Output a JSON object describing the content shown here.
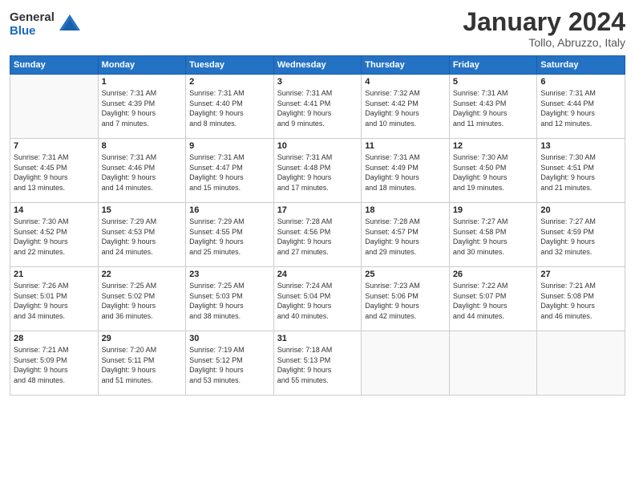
{
  "logo": {
    "general": "General",
    "blue": "Blue"
  },
  "title": "January 2024",
  "location": "Tollo, Abruzzo, Italy",
  "days_of_week": [
    "Sunday",
    "Monday",
    "Tuesday",
    "Wednesday",
    "Thursday",
    "Friday",
    "Saturday"
  ],
  "weeks": [
    [
      {
        "day": "",
        "info": ""
      },
      {
        "day": "1",
        "info": "Sunrise: 7:31 AM\nSunset: 4:39 PM\nDaylight: 9 hours\nand 7 minutes."
      },
      {
        "day": "2",
        "info": "Sunrise: 7:31 AM\nSunset: 4:40 PM\nDaylight: 9 hours\nand 8 minutes."
      },
      {
        "day": "3",
        "info": "Sunrise: 7:31 AM\nSunset: 4:41 PM\nDaylight: 9 hours\nand 9 minutes."
      },
      {
        "day": "4",
        "info": "Sunrise: 7:32 AM\nSunset: 4:42 PM\nDaylight: 9 hours\nand 10 minutes."
      },
      {
        "day": "5",
        "info": "Sunrise: 7:31 AM\nSunset: 4:43 PM\nDaylight: 9 hours\nand 11 minutes."
      },
      {
        "day": "6",
        "info": "Sunrise: 7:31 AM\nSunset: 4:44 PM\nDaylight: 9 hours\nand 12 minutes."
      }
    ],
    [
      {
        "day": "7",
        "info": "Sunrise: 7:31 AM\nSunset: 4:45 PM\nDaylight: 9 hours\nand 13 minutes."
      },
      {
        "day": "8",
        "info": "Sunrise: 7:31 AM\nSunset: 4:46 PM\nDaylight: 9 hours\nand 14 minutes."
      },
      {
        "day": "9",
        "info": "Sunrise: 7:31 AM\nSunset: 4:47 PM\nDaylight: 9 hours\nand 15 minutes."
      },
      {
        "day": "10",
        "info": "Sunrise: 7:31 AM\nSunset: 4:48 PM\nDaylight: 9 hours\nand 17 minutes."
      },
      {
        "day": "11",
        "info": "Sunrise: 7:31 AM\nSunset: 4:49 PM\nDaylight: 9 hours\nand 18 minutes."
      },
      {
        "day": "12",
        "info": "Sunrise: 7:30 AM\nSunset: 4:50 PM\nDaylight: 9 hours\nand 19 minutes."
      },
      {
        "day": "13",
        "info": "Sunrise: 7:30 AM\nSunset: 4:51 PM\nDaylight: 9 hours\nand 21 minutes."
      }
    ],
    [
      {
        "day": "14",
        "info": "Sunrise: 7:30 AM\nSunset: 4:52 PM\nDaylight: 9 hours\nand 22 minutes."
      },
      {
        "day": "15",
        "info": "Sunrise: 7:29 AM\nSunset: 4:53 PM\nDaylight: 9 hours\nand 24 minutes."
      },
      {
        "day": "16",
        "info": "Sunrise: 7:29 AM\nSunset: 4:55 PM\nDaylight: 9 hours\nand 25 minutes."
      },
      {
        "day": "17",
        "info": "Sunrise: 7:28 AM\nSunset: 4:56 PM\nDaylight: 9 hours\nand 27 minutes."
      },
      {
        "day": "18",
        "info": "Sunrise: 7:28 AM\nSunset: 4:57 PM\nDaylight: 9 hours\nand 29 minutes."
      },
      {
        "day": "19",
        "info": "Sunrise: 7:27 AM\nSunset: 4:58 PM\nDaylight: 9 hours\nand 30 minutes."
      },
      {
        "day": "20",
        "info": "Sunrise: 7:27 AM\nSunset: 4:59 PM\nDaylight: 9 hours\nand 32 minutes."
      }
    ],
    [
      {
        "day": "21",
        "info": "Sunrise: 7:26 AM\nSunset: 5:01 PM\nDaylight: 9 hours\nand 34 minutes."
      },
      {
        "day": "22",
        "info": "Sunrise: 7:25 AM\nSunset: 5:02 PM\nDaylight: 9 hours\nand 36 minutes."
      },
      {
        "day": "23",
        "info": "Sunrise: 7:25 AM\nSunset: 5:03 PM\nDaylight: 9 hours\nand 38 minutes."
      },
      {
        "day": "24",
        "info": "Sunrise: 7:24 AM\nSunset: 5:04 PM\nDaylight: 9 hours\nand 40 minutes."
      },
      {
        "day": "25",
        "info": "Sunrise: 7:23 AM\nSunset: 5:06 PM\nDaylight: 9 hours\nand 42 minutes."
      },
      {
        "day": "26",
        "info": "Sunrise: 7:22 AM\nSunset: 5:07 PM\nDaylight: 9 hours\nand 44 minutes."
      },
      {
        "day": "27",
        "info": "Sunrise: 7:21 AM\nSunset: 5:08 PM\nDaylight: 9 hours\nand 46 minutes."
      }
    ],
    [
      {
        "day": "28",
        "info": "Sunrise: 7:21 AM\nSunset: 5:09 PM\nDaylight: 9 hours\nand 48 minutes."
      },
      {
        "day": "29",
        "info": "Sunrise: 7:20 AM\nSunset: 5:11 PM\nDaylight: 9 hours\nand 51 minutes."
      },
      {
        "day": "30",
        "info": "Sunrise: 7:19 AM\nSunset: 5:12 PM\nDaylight: 9 hours\nand 53 minutes."
      },
      {
        "day": "31",
        "info": "Sunrise: 7:18 AM\nSunset: 5:13 PM\nDaylight: 9 hours\nand 55 minutes."
      },
      {
        "day": "",
        "info": ""
      },
      {
        "day": "",
        "info": ""
      },
      {
        "day": "",
        "info": ""
      }
    ]
  ]
}
